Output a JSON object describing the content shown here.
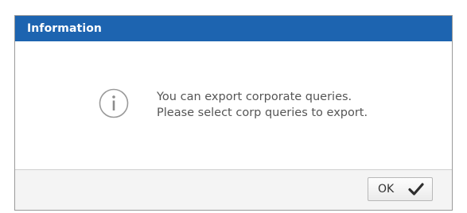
{
  "dialog": {
    "title": "Information",
    "message_line1": "You can export corporate queries.",
    "message_line2": "Please select corp queries to export.",
    "icon": "info-icon",
    "ok_label": "OK",
    "ok_icon": "checkmark-icon"
  },
  "colors": {
    "titlebar": "#1d64b0",
    "title_text": "#ffffff",
    "message_text": "#555555",
    "footer_bg": "#f4f4f4"
  }
}
